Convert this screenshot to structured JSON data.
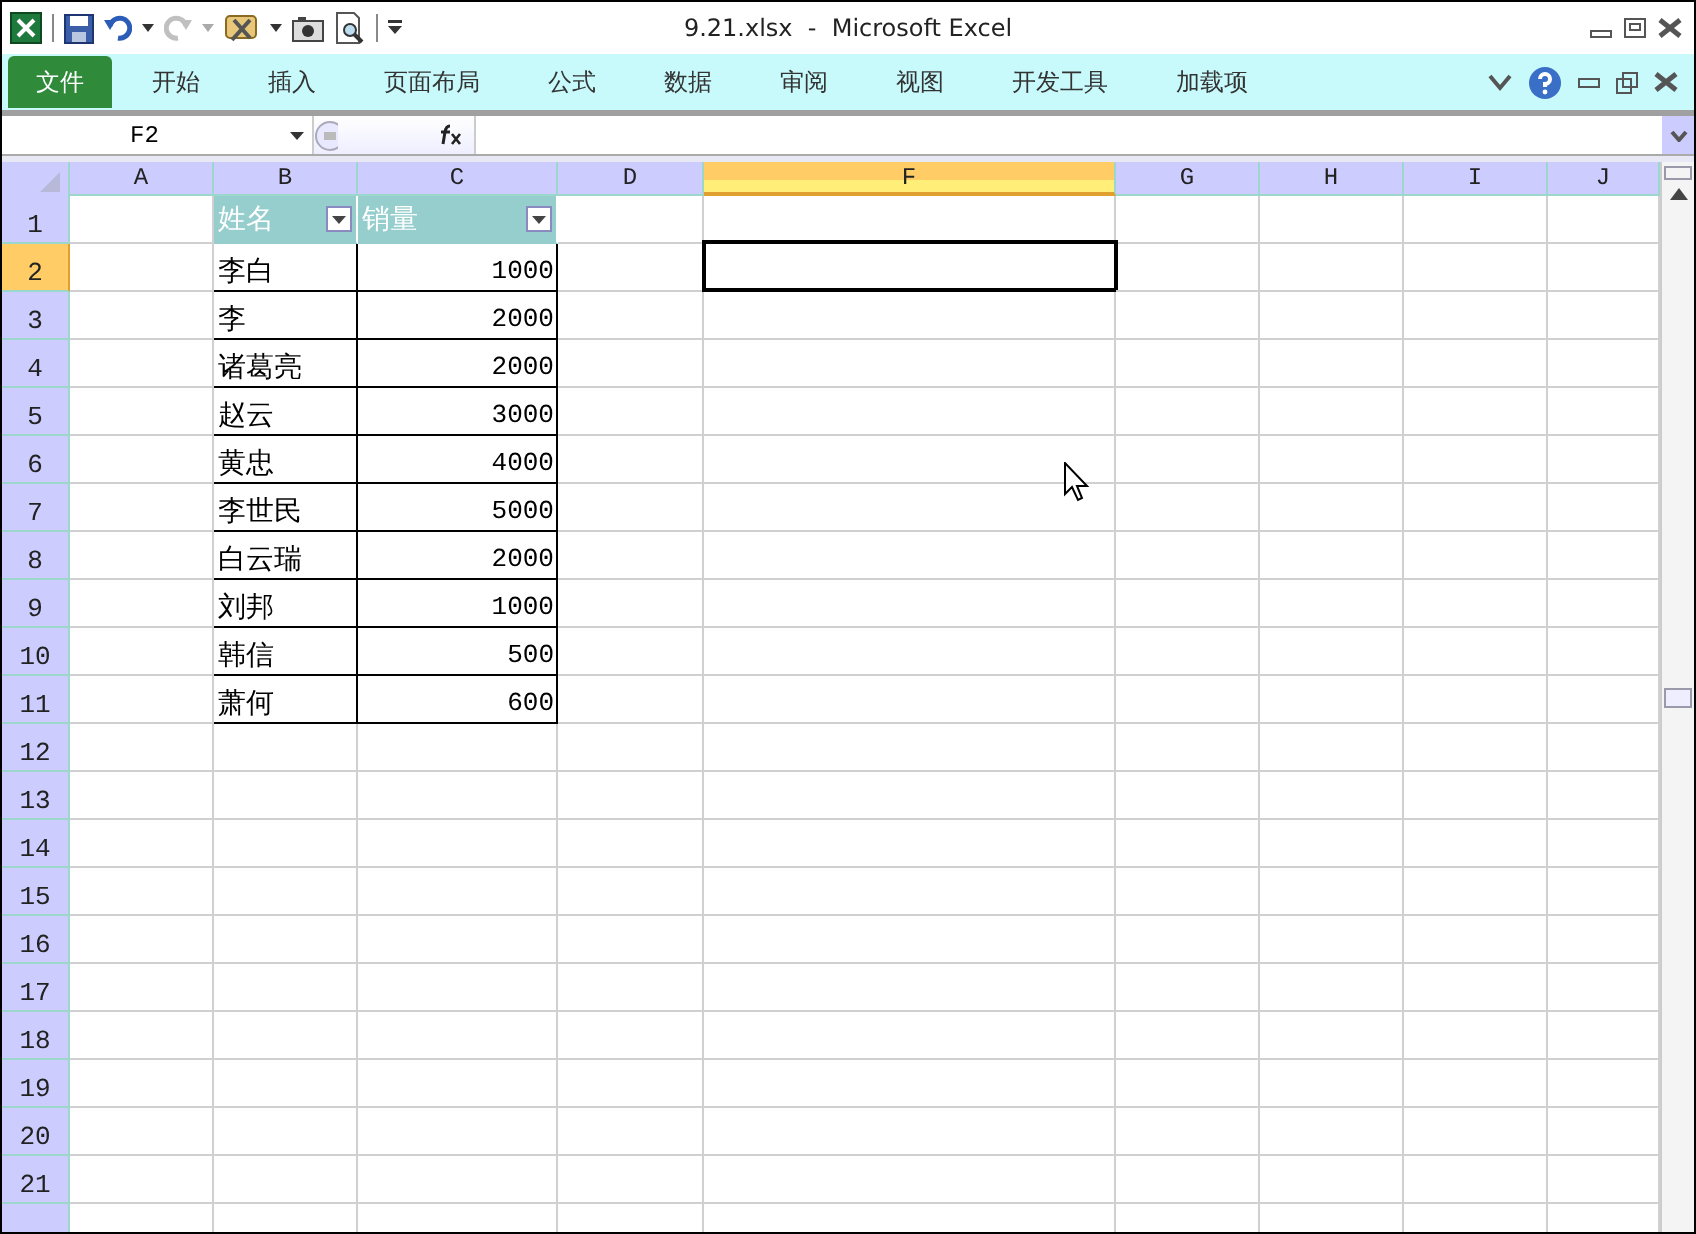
{
  "window": {
    "title": "9.21.xlsx  -  Microsoft Excel"
  },
  "ribbon_tabs": [
    {
      "label": "文件",
      "selected": true
    },
    {
      "label": "开始",
      "selected": false
    },
    {
      "label": "插入",
      "selected": false
    },
    {
      "label": "页面布局",
      "selected": false
    },
    {
      "label": "公式",
      "selected": false
    },
    {
      "label": "数据",
      "selected": false
    },
    {
      "label": "审阅",
      "selected": false
    },
    {
      "label": "视图",
      "selected": false
    },
    {
      "label": "开发工具",
      "selected": false
    },
    {
      "label": "加载项",
      "selected": false
    }
  ],
  "name_box": "F2",
  "columns": [
    {
      "label": "A",
      "selected": false
    },
    {
      "label": "B",
      "selected": false
    },
    {
      "label": "C",
      "selected": false
    },
    {
      "label": "D",
      "selected": false
    },
    {
      "label": "F",
      "selected": true
    },
    {
      "label": "G",
      "selected": false
    },
    {
      "label": "H",
      "selected": false
    },
    {
      "label": "I",
      "selected": false
    },
    {
      "label": "J",
      "selected": false
    }
  ],
  "rows": [
    {
      "label": "1",
      "selected": false
    },
    {
      "label": "2",
      "selected": true
    },
    {
      "label": "3",
      "selected": false
    },
    {
      "label": "4",
      "selected": false
    },
    {
      "label": "5",
      "selected": false
    },
    {
      "label": "6",
      "selected": false
    },
    {
      "label": "7",
      "selected": false
    },
    {
      "label": "8",
      "selected": false
    },
    {
      "label": "9",
      "selected": false
    },
    {
      "label": "10",
      "selected": false
    },
    {
      "label": "11",
      "selected": false
    },
    {
      "label": "12",
      "selected": false
    },
    {
      "label": "13",
      "selected": false
    },
    {
      "label": "14",
      "selected": false
    },
    {
      "label": "15",
      "selected": false
    },
    {
      "label": "16",
      "selected": false
    },
    {
      "label": "17",
      "selected": false
    },
    {
      "label": "18",
      "selected": false
    },
    {
      "label": "19",
      "selected": false
    },
    {
      "label": "20",
      "selected": false
    },
    {
      "label": "21",
      "selected": false
    }
  ],
  "table": {
    "headers": [
      "姓名",
      "销量"
    ],
    "rows": [
      {
        "name": "李白",
        "sales": "1000"
      },
      {
        "name": "李",
        "sales": "2000"
      },
      {
        "name": "诸葛亮",
        "sales": "2000"
      },
      {
        "name": "赵云",
        "sales": "3000"
      },
      {
        "name": "黄忠",
        "sales": "4000"
      },
      {
        "name": "李世民",
        "sales": "5000"
      },
      {
        "name": "白云瑞",
        "sales": "2000"
      },
      {
        "name": "刘邦",
        "sales": "1000"
      },
      {
        "name": "韩信",
        "sales": "500"
      },
      {
        "name": "萧何",
        "sales": "600"
      }
    ]
  }
}
